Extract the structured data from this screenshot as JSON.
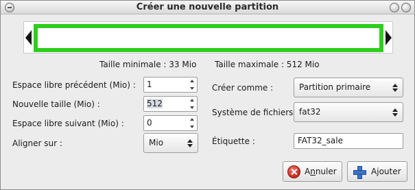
{
  "window": {
    "title": "Créer une nouvelle partition"
  },
  "resizer": {
    "bar_color": "#2ece1c"
  },
  "sizes": {
    "min_label": "Taille minimale : 33 Mio",
    "max_label": "Taille maximale : 512 Mio"
  },
  "form_left": {
    "free_before": {
      "label": "Espace libre précédent (Mio) :",
      "value": "1"
    },
    "new_size": {
      "label": "Nouvelle taille (Mio) :",
      "value": "512"
    },
    "free_after": {
      "label": "Espace libre suivant (Mio) :",
      "value": "0"
    },
    "align": {
      "label": "Aligner sur :",
      "value": "Mio"
    }
  },
  "form_right": {
    "create_as": {
      "label": "Créer comme :",
      "value": "Partition primaire"
    },
    "filesystem": {
      "label": "Système de fichiers :",
      "value": "fat32"
    },
    "volume_label": {
      "label": "Étiquette :",
      "value": "FAT32_sale"
    }
  },
  "buttons": {
    "cancel_pre": "A",
    "cancel_accel": "n",
    "cancel_post": "nuler",
    "add_pre": "A",
    "add_accel": "j",
    "add_post": "outer"
  },
  "icons": {
    "cancel": "cancel-icon",
    "add": "add-icon"
  }
}
